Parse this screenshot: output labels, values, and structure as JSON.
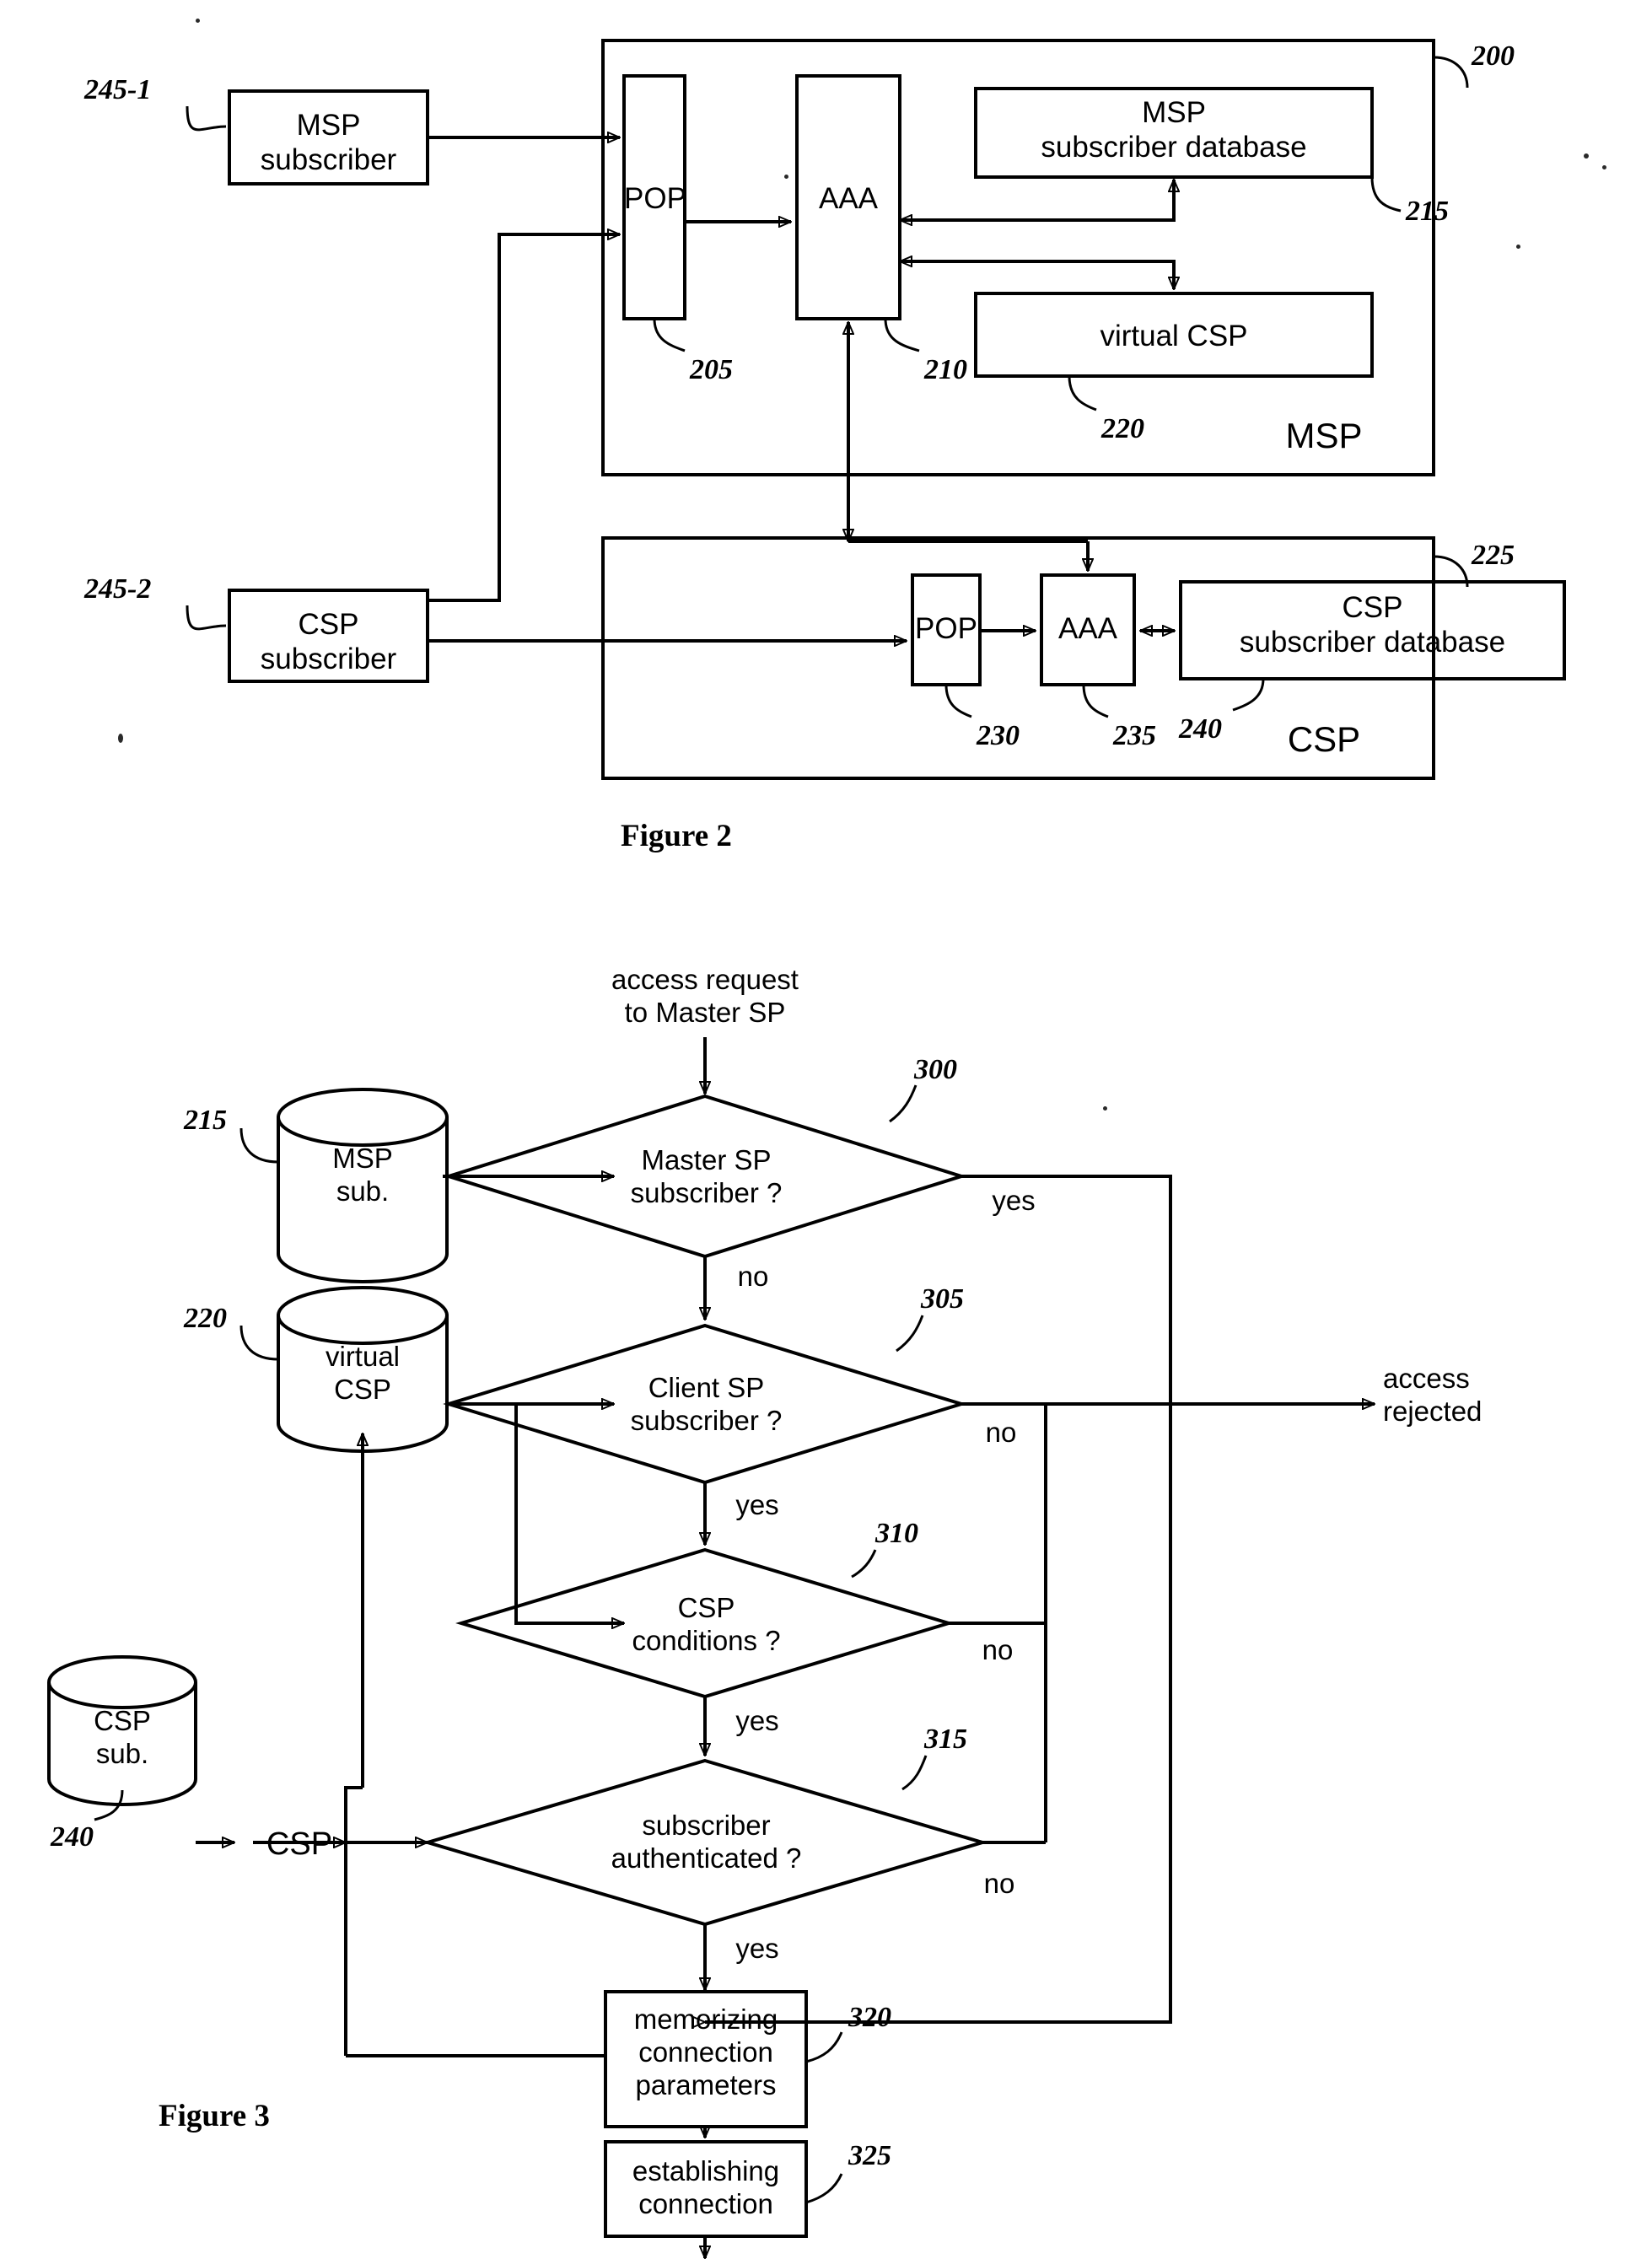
{
  "figure2": {
    "caption": "Figure 2",
    "container_msp": {
      "label": "MSP",
      "ref": "200"
    },
    "container_csp": {
      "label": "CSP",
      "ref": "225"
    },
    "nodes": [
      {
        "id": "msp-subscriber",
        "text": "MSP\nsubscriber",
        "ref": "245-1"
      },
      {
        "id": "csp-subscriber",
        "text": "CSP\nsubscriber",
        "ref": "245-2"
      },
      {
        "id": "msp-pop",
        "text": "POP",
        "ref": "205"
      },
      {
        "id": "msp-aaa",
        "text": "AAA",
        "ref": "210"
      },
      {
        "id": "msp-subdb",
        "text": "MSP\nsubscriber database",
        "ref": "215"
      },
      {
        "id": "virtual-csp",
        "text": "virtual CSP",
        "ref": "220"
      },
      {
        "id": "csp-pop",
        "text": "POP",
        "ref": "230"
      },
      {
        "id": "csp-aaa",
        "text": "AAA",
        "ref": "235"
      },
      {
        "id": "csp-subdb",
        "text": "CSP\nsubscriber database",
        "ref": "240"
      }
    ]
  },
  "figure3": {
    "caption": "Figure 3",
    "entry_label": "access request\nto Master SP",
    "exit_label": "access\nrejected",
    "csp_out_label": "CSP",
    "stores": [
      {
        "id": "msp-sub-store",
        "text": "MSP\nsub.",
        "ref": "215"
      },
      {
        "id": "virtual-csp-store",
        "text": "virtual\nCSP",
        "ref": "220"
      },
      {
        "id": "csp-sub-store",
        "text": "CSP\nsub.",
        "ref": "240"
      }
    ],
    "decisions": [
      {
        "id": "d300",
        "text": "Master SP\nsubscriber ?",
        "ref": "300",
        "branch_right": "yes",
        "branch_down": "no"
      },
      {
        "id": "d305",
        "text": "Client SP\nsubscriber ?",
        "ref": "305",
        "branch_right": "no",
        "branch_down": "yes"
      },
      {
        "id": "d310",
        "text": "CSP\nconditions ?",
        "ref": "310",
        "branch_right": "no",
        "branch_down": "yes"
      },
      {
        "id": "d315",
        "text": "subscriber\nauthenticated ?",
        "ref": "315",
        "branch_right": "no",
        "branch_down": "yes"
      }
    ],
    "processes": [
      {
        "id": "p320",
        "text": "memorizing\nconnection\nparameters",
        "ref": "320"
      },
      {
        "id": "p325",
        "text": "establishing\nconnection",
        "ref": "325"
      }
    ]
  },
  "colors": {
    "ink": "#000000",
    "paper": "#ffffff"
  }
}
